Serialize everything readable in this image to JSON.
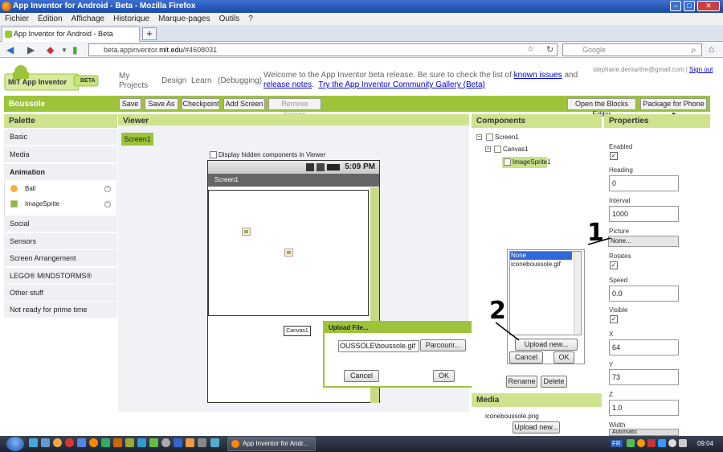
{
  "window": {
    "title": "App Inventor for Android - Beta - Mozilla Firefox"
  },
  "menu": [
    "Fichier",
    "Édition",
    "Affichage",
    "Historique",
    "Marque-pages",
    "Outils",
    "?"
  ],
  "browser": {
    "tab_title": "App Inventor for Android - Beta",
    "url_prefix": "beta.appinventor.",
    "url_domain": "mit.edu",
    "url_suffix": "/#4608031",
    "search_placeholder": "Google"
  },
  "header": {
    "logo_text": "MIT App Inventor",
    "beta_badge": "BETA",
    "links": [
      "My Projects",
      "Design",
      "Learn",
      "(Debugging)"
    ],
    "welcome_pre": "Welcome to the App Inventor beta release. Be sure to check the list of ",
    "known_issues": "known issues",
    "and": " and ",
    "release_notes": "release notes",
    "gallery_link": "Try the App Inventor Community Gallery (Beta)",
    "user_email": "stephane.demarthe@gmail.com",
    "sign_out": "Sign out"
  },
  "project": {
    "name": "Boussole",
    "buttons": [
      "Save",
      "Save As",
      "Checkpoint",
      "Add Screen",
      "Remove Screen"
    ],
    "blocks_editor": "Open the Blocks Editor",
    "package": "Package for Phone ▾"
  },
  "palette": {
    "header": "Palette",
    "categories_top": [
      "Basic",
      "Media",
      "Animation"
    ],
    "animation_items": [
      "Ball",
      "ImageSprite"
    ],
    "categories_bottom": [
      "Social",
      "Sensors",
      "Screen Arrangement",
      "LEGO® MINDSTORMS®",
      "Other stuff",
      "Not ready for prime time"
    ]
  },
  "viewer": {
    "header": "Viewer",
    "screen_tab": "Screen1",
    "hidden_components": "Display hidden components in Viewer",
    "time": "5:09 PM",
    "screen_title": "Screen1",
    "canvas_label": "Canvas1"
  },
  "upload_dialog": {
    "title": "Upload File...",
    "file_value": "OUSSOLE\\boussole.gif",
    "browse": "Parcourir...",
    "cancel": "Cancel",
    "ok": "OK"
  },
  "components": {
    "header": "Components",
    "tree": [
      "Screen1",
      "Canvas1",
      "ImageSprite1"
    ],
    "rename": "Rename",
    "delete": "Delete"
  },
  "picker": {
    "options": [
      "None",
      "iconeboussole.gif"
    ],
    "upload_new": "Upload new...",
    "cancel": "Cancel",
    "ok": "OK"
  },
  "media": {
    "header": "Media",
    "file": "iconeboussole.png",
    "upload_new": "Upload new..."
  },
  "properties": {
    "header": "Properties",
    "enabled_label": "Enabled",
    "heading_label": "Heading",
    "heading_value": "0",
    "interval_label": "Interval",
    "interval_value": "1000",
    "picture_label": "Picture",
    "picture_value": "None...",
    "rotates_label": "Rotates",
    "speed_label": "Speed",
    "speed_value": "0.0",
    "visible_label": "Visible",
    "x_label": "X",
    "x_value": "64",
    "y_label": "Y",
    "y_value": "73",
    "z_label": "Z",
    "z_value": "1.0",
    "width_label": "Width",
    "width_value": "Automatic"
  },
  "annotations": [
    "1",
    "2"
  ],
  "taskbar": {
    "task": "App Inventor for Andr...",
    "lang": "FR",
    "clock": "09:04"
  },
  "colors": {
    "accent_green": "#9cc43a",
    "panel_header": "#cfe38f",
    "title_blue": "#1b4aa6"
  }
}
